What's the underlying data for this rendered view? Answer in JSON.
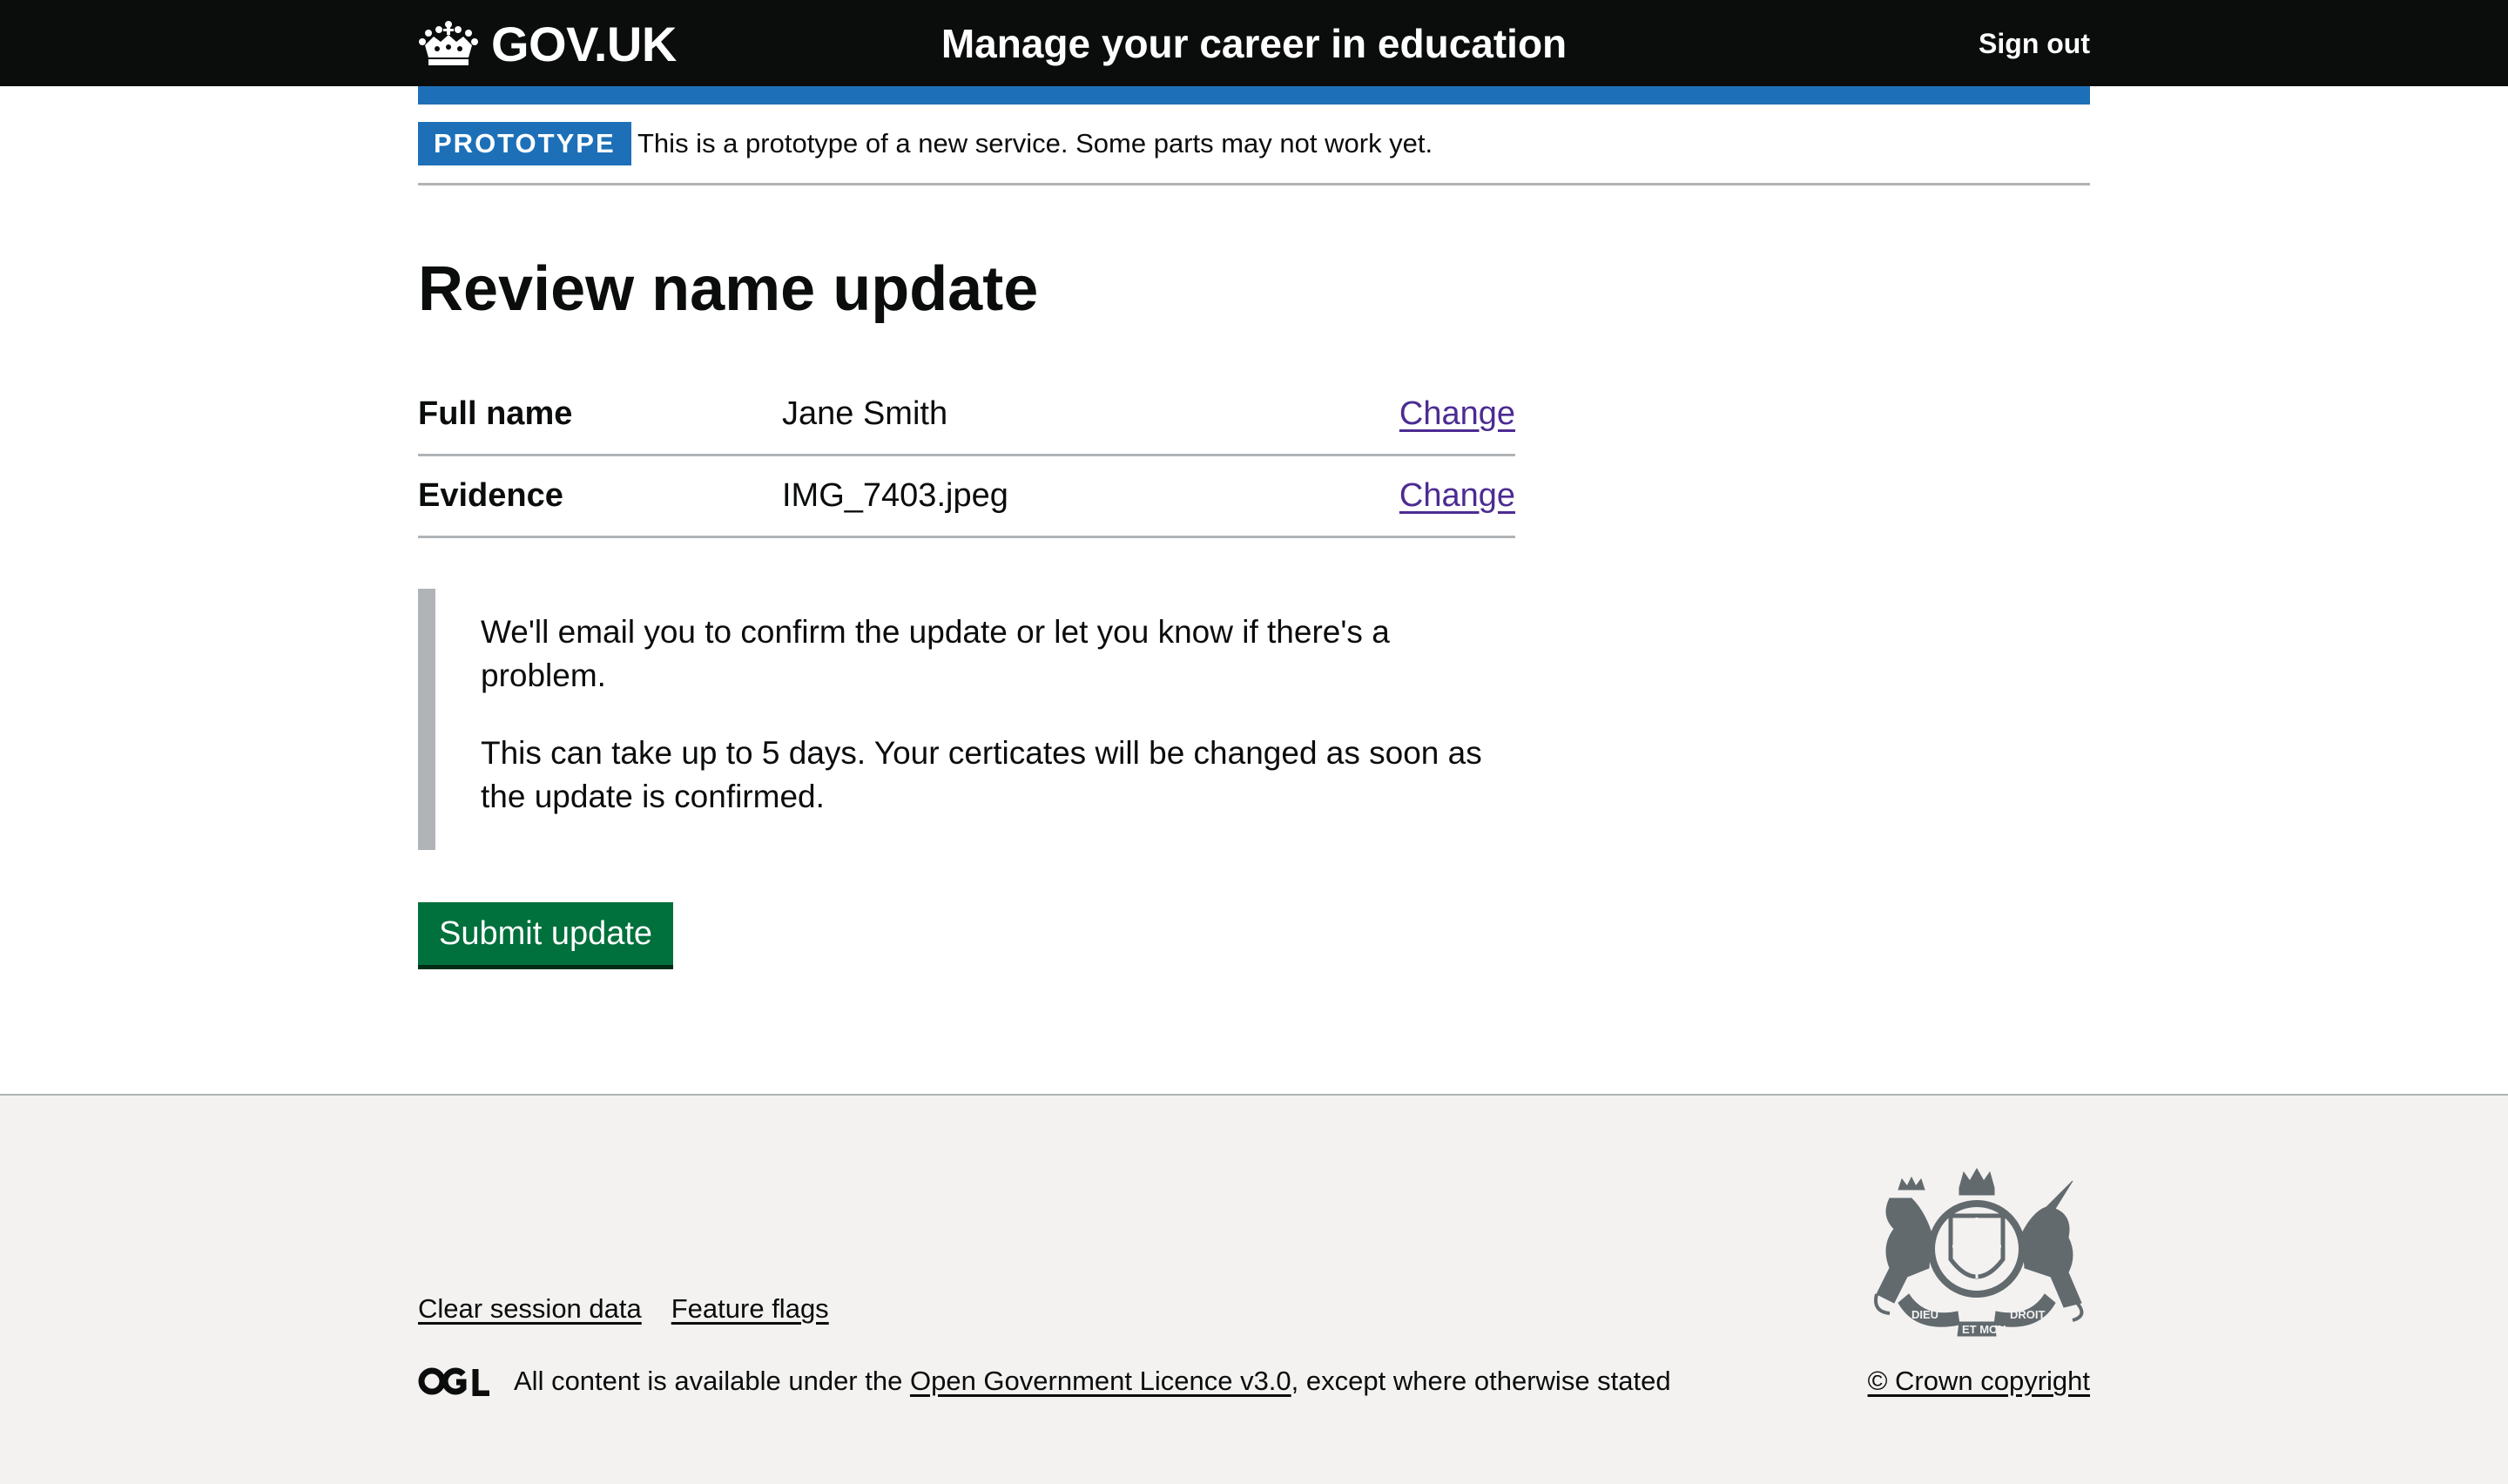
{
  "header": {
    "logotype": "GOV.UK",
    "service_name": "Manage your career in education",
    "sign_out": "Sign out"
  },
  "phase_banner": {
    "tag": "PROTOTYPE",
    "text": "This is a prototype of a new service. Some parts may not work yet."
  },
  "main": {
    "title": "Review name update",
    "summary": [
      {
        "key": "Full name",
        "value": "Jane Smith",
        "action": "Change"
      },
      {
        "key": "Evidence",
        "value": "IMG_7403.jpeg",
        "action": "Change"
      }
    ],
    "inset": {
      "p1": "We'll email you to confirm the update or let you know if there's a problem.",
      "p2": "This can take up to 5 days. Your certicates will be changed as soon as the update is confirmed."
    },
    "submit_label": "Submit update"
  },
  "footer": {
    "links": [
      "Clear session data",
      "Feature flags"
    ],
    "licence_prefix": "All content is available under the",
    "licence_link": "Open Government Licence v3.0",
    "licence_suffix": ", except where otherwise stated",
    "copyright": "© Crown copyright",
    "crest_motto_1": "DIEU",
    "crest_motto_2": "ET MON",
    "crest_motto_3": "DROIT"
  },
  "colors": {
    "header_bg": "#0b0c0c",
    "brand_blue": "#1d70b8",
    "button_green": "#00703c",
    "link_purple": "#4c2c92",
    "footer_bg": "#f3f2f1",
    "border_grey": "#b1b4b6"
  },
  "icons": {
    "crown": "crown-icon",
    "ogl": "ogl-logo-icon",
    "crest": "royal-coat-of-arms-icon"
  }
}
